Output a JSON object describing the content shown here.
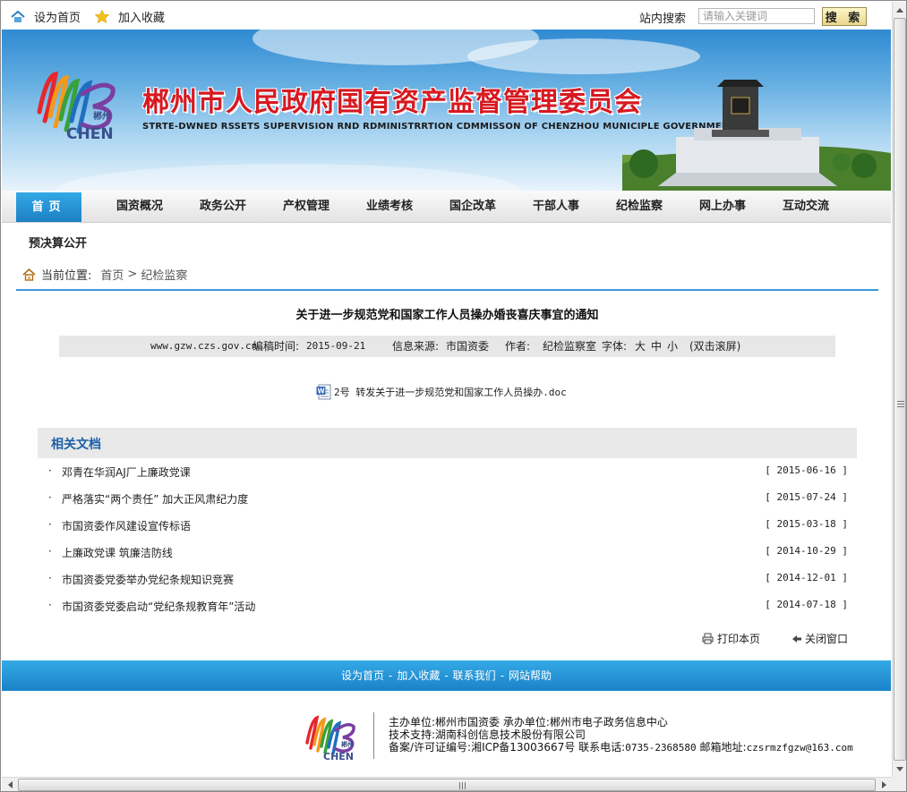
{
  "topbar": {
    "set_home": "设为首页",
    "add_favorite": "加入收藏",
    "site_search_label": "站内搜索",
    "search_placeholder": "请输入关键词",
    "search_button": "搜 索"
  },
  "banner": {
    "logo_text": "CHEN",
    "logo_city": "郴州",
    "title_cn": "郴州市人民政府国有资产监督管理委员会",
    "title_en": "STRTE-DWNED RSSETS SUPERVISION RND RDMINISTRRTION CDMMISSON OF CHENZHOU MUNICIPLE GOVERNMENT"
  },
  "nav": {
    "items": [
      {
        "label": "首页",
        "active": true
      },
      {
        "label": "国资概况",
        "active": false
      },
      {
        "label": "政务公开",
        "active": false
      },
      {
        "label": "产权管理",
        "active": false
      },
      {
        "label": "业绩考核",
        "active": false
      },
      {
        "label": "国企改革",
        "active": false
      },
      {
        "label": "干部人事",
        "active": false
      },
      {
        "label": "纪检监察",
        "active": false
      },
      {
        "label": "网上办事",
        "active": false
      },
      {
        "label": "互动交流",
        "active": false
      }
    ],
    "sub_item": "预决算公开"
  },
  "breadcrumb": {
    "label": "当前位置:",
    "home": "首页",
    "separator": ">",
    "current": "纪检监察"
  },
  "article": {
    "title": "关于进一步规范党和国家工作人员操办婚丧喜庆事宜的通知",
    "site": "www.gzw.czs.gov.cn",
    "edit_time_label": "编稿时间:",
    "edit_time": "2015-09-21",
    "source_label": "信息来源:",
    "source": "市国资委",
    "author_label": "作者:",
    "author": "纪检监察室",
    "font_label": "字体:",
    "font_large": "大",
    "font_medium": "中",
    "font_small": "小",
    "auto_scroll": "(双击滚屏)",
    "attachment_name": "2号 转发关于进一步规范党和国家工作人员操办.doc"
  },
  "related": {
    "heading": "相关文档",
    "bullet": "·",
    "items": [
      {
        "title": "邓青在华润AJ厂上廉政党课",
        "date": "[ 2015-06-16 ]"
      },
      {
        "title": "严格落实“两个责任” 加大正风肃纪力度",
        "date": "[ 2015-07-24 ]"
      },
      {
        "title": "市国资委作风建设宣传标语",
        "date": "[ 2015-03-18 ]"
      },
      {
        "title": "上廉政党课 筑廉洁防线",
        "date": "[ 2014-10-29 ]"
      },
      {
        "title": "市国资委党委举办党纪条规知识竞赛",
        "date": "[ 2014-12-01 ]"
      },
      {
        "title": "市国资委党委启动“党纪条规教育年”活动",
        "date": "[ 2014-07-18 ]"
      }
    ]
  },
  "actions": {
    "print": "打印本页",
    "close": "关闭窗口"
  },
  "footer": {
    "links": [
      "设为首页",
      "加入收藏",
      "联系我们",
      "网站帮助"
    ],
    "separator": "-",
    "host": "主办单位:郴州市国资委  承办单位:郴州市电子政务信息中心",
    "tech": "技术支持:湖南科创信息技术股份有限公司",
    "icp_label": "备案/许可证编号:",
    "icp": "湘ICP备13003667号",
    "phone_label": "联系电话:",
    "phone": "0735-2368580",
    "email_label": "邮箱地址:",
    "email": "czsrmzfgzw@163.com",
    "logo_text": "CHEN",
    "logo_city": "郴州"
  },
  "colors": {
    "accent_blue": "#1c7fc4",
    "title_red": "#d71921",
    "related_heading": "#1b5fa6"
  }
}
